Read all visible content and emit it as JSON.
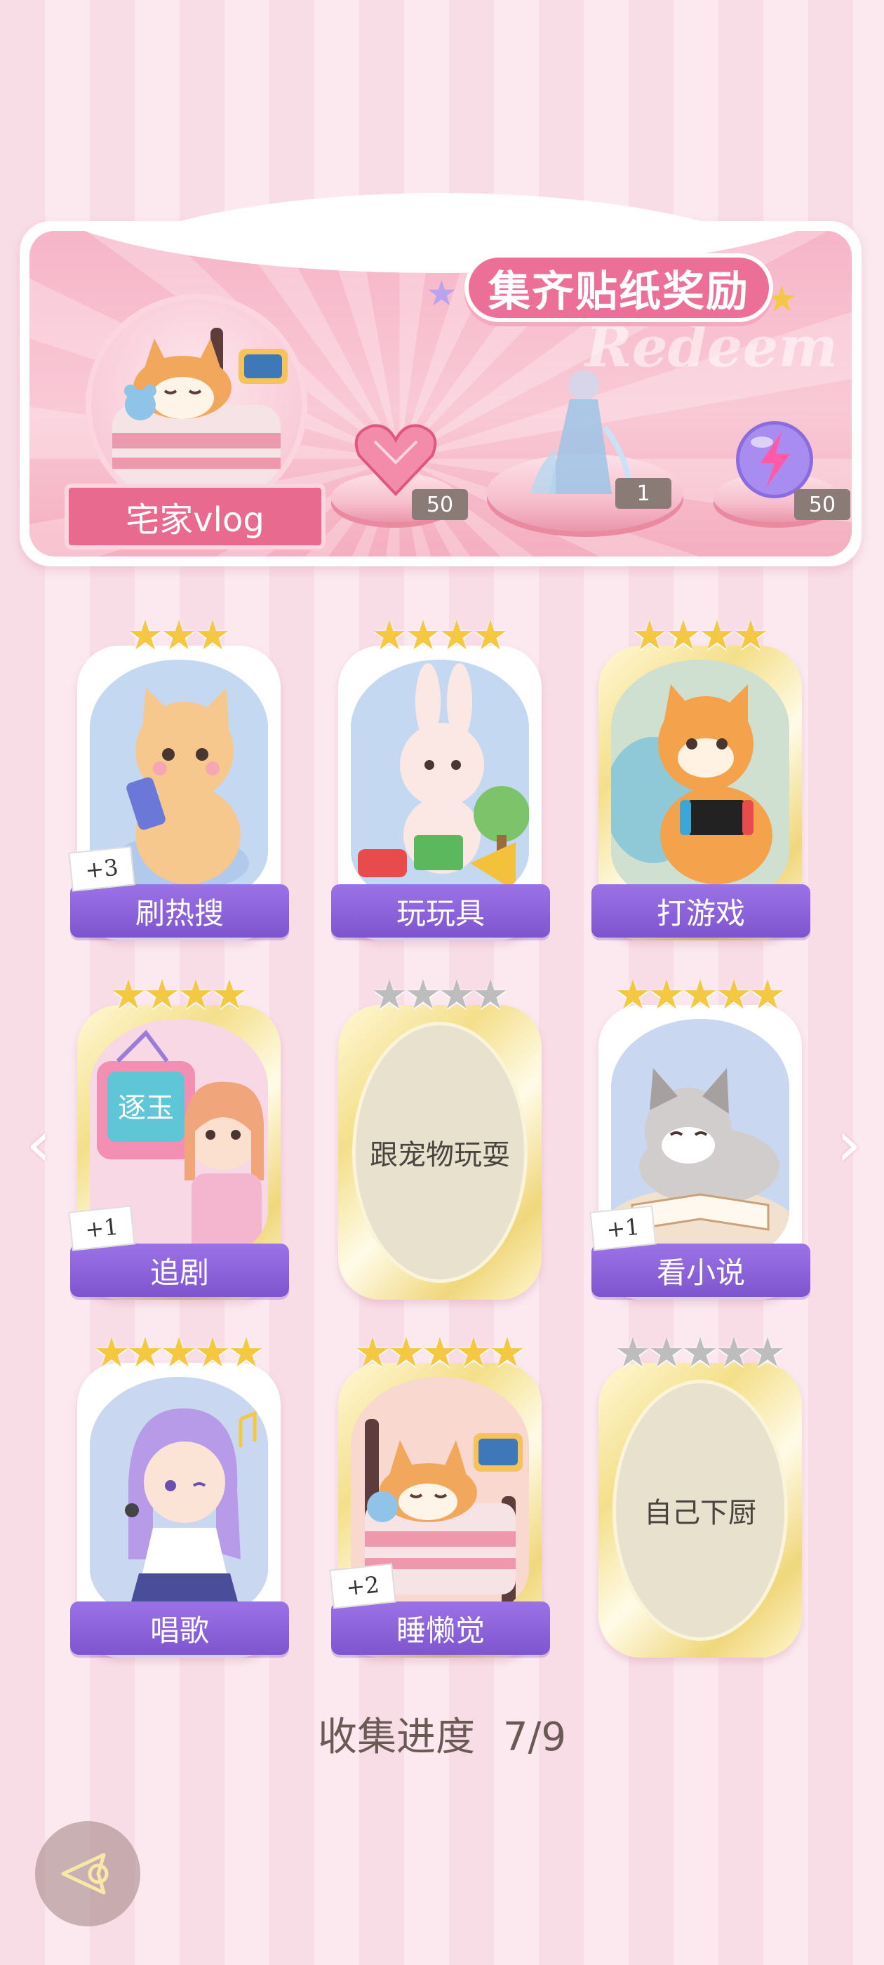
{
  "reward_banner": {
    "title": "集齐贴纸奖励",
    "watermark": "Redeem",
    "theme_label": "宅家vlog",
    "rewards": [
      {
        "icon": "heart-gem-icon",
        "count": "50"
      },
      {
        "icon": "fairy-doll-icon",
        "count": "1"
      },
      {
        "icon": "lightning-orb-icon",
        "count": "50"
      }
    ]
  },
  "stickers": [
    {
      "label": "刷热搜",
      "stars_on": 3,
      "stars_total": 3,
      "bonus": "+3",
      "collected": true,
      "frame": "silver",
      "icon": "cat-phone-icon"
    },
    {
      "label": "玩玩具",
      "stars_on": 4,
      "stars_total": 4,
      "bonus": "",
      "collected": true,
      "frame": "silver",
      "icon": "bunny-toys-icon"
    },
    {
      "label": "打游戏",
      "stars_on": 4,
      "stars_total": 4,
      "bonus": "",
      "collected": true,
      "frame": "gold",
      "icon": "cat-gaming-icon"
    },
    {
      "label": "追剧",
      "stars_on": 4,
      "stars_total": 4,
      "bonus": "+1",
      "collected": true,
      "frame": "gold",
      "icon": "girl-tv-icon",
      "tv_text": "逐玉"
    },
    {
      "label": "跟宠物玩耍",
      "stars_on": 0,
      "stars_total": 4,
      "bonus": "",
      "collected": false,
      "frame": "gold",
      "icon": ""
    },
    {
      "label": "看小说",
      "stars_on": 5,
      "stars_total": 5,
      "bonus": "+1",
      "collected": true,
      "frame": "silver",
      "icon": "cat-reading-icon"
    },
    {
      "label": "唱歌",
      "stars_on": 5,
      "stars_total": 5,
      "bonus": "",
      "collected": true,
      "frame": "silver",
      "icon": "girl-singing-icon"
    },
    {
      "label": "睡懒觉",
      "stars_on": 5,
      "stars_total": 5,
      "bonus": "+2",
      "collected": true,
      "frame": "gold",
      "icon": "cat-sleeping-icon"
    },
    {
      "label": "自己下厨",
      "stars_on": 0,
      "stars_total": 5,
      "bonus": "",
      "collected": false,
      "frame": "gold",
      "icon": ""
    }
  ],
  "progress": {
    "label": "收集进度",
    "value": "7/9"
  },
  "colors": {
    "accent_purple": "#8a5fd8",
    "banner_pink": "#ec6f97",
    "star_gold": "#f5c843"
  }
}
